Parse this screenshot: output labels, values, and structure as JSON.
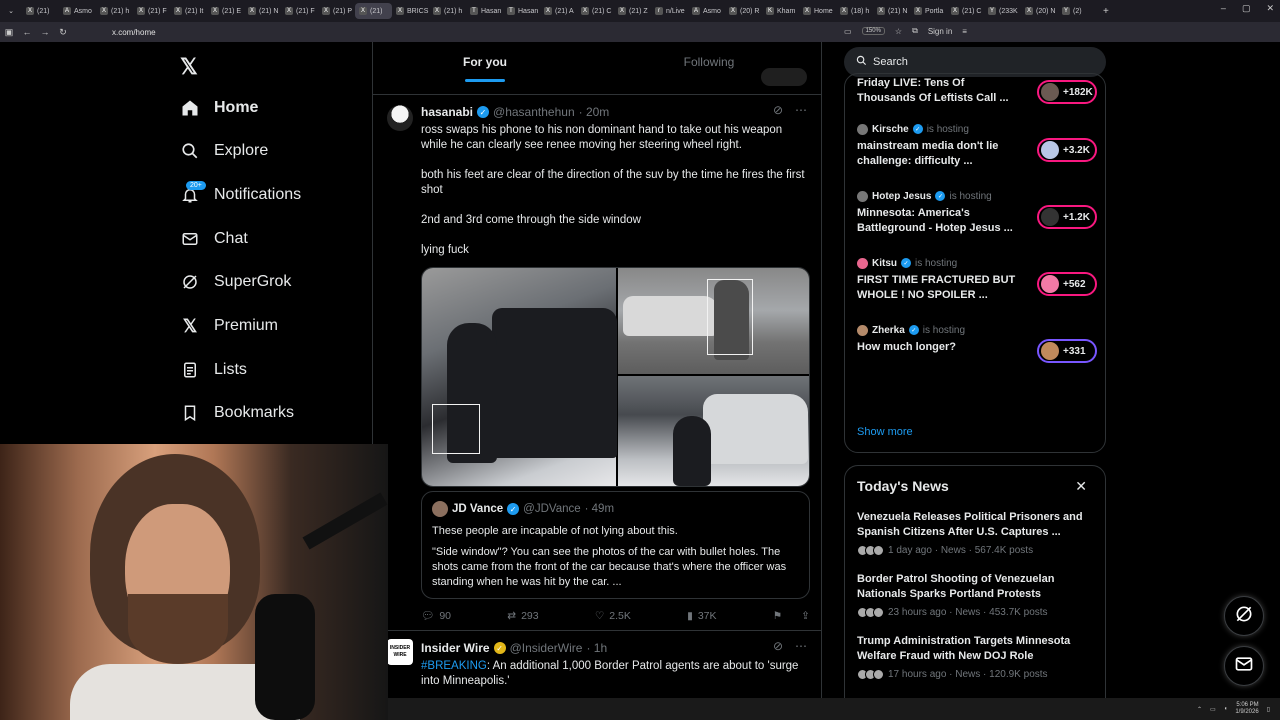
{
  "browser": {
    "tabs": [
      {
        "label": "(21)",
        "fav": "X"
      },
      {
        "label": "Asmo",
        "fav": "A"
      },
      {
        "label": "(21) h",
        "fav": "X"
      },
      {
        "label": "(21) F",
        "fav": "X"
      },
      {
        "label": "(21) It",
        "fav": "X"
      },
      {
        "label": "(21) E",
        "fav": "X"
      },
      {
        "label": "(21) N",
        "fav": "X"
      },
      {
        "label": "(21) F",
        "fav": "X"
      },
      {
        "label": "(21) P",
        "fav": "X"
      },
      {
        "label": "(21)",
        "fav": "X"
      },
      {
        "label": "BRICS",
        "fav": "X"
      },
      {
        "label": "(21) h",
        "fav": "X"
      },
      {
        "label": "Hasan",
        "fav": "T"
      },
      {
        "label": "Hasan",
        "fav": "T"
      },
      {
        "label": "(21) A",
        "fav": "X"
      },
      {
        "label": "(21) C",
        "fav": "X"
      },
      {
        "label": "(21) Z",
        "fav": "X"
      },
      {
        "label": "n/Live",
        "fav": "r"
      },
      {
        "label": "Asmo",
        "fav": "A"
      },
      {
        "label": "(20) R",
        "fav": "X"
      },
      {
        "label": "Kham",
        "fav": "K"
      },
      {
        "label": "Home",
        "fav": "X"
      },
      {
        "label": "(18) h",
        "fav": "X"
      },
      {
        "label": "(21) N",
        "fav": "X"
      },
      {
        "label": "Portla",
        "fav": "X"
      },
      {
        "label": "(21) C",
        "fav": "X"
      },
      {
        "label": "(233K",
        "fav": "Y"
      },
      {
        "label": "(20) N",
        "fav": "X"
      },
      {
        "label": "(2)",
        "fav": "Y"
      }
    ],
    "url": "x.com/home",
    "zoom": "150%",
    "sign_in": "Sign in"
  },
  "sidebar": {
    "items": [
      {
        "label": "Home",
        "icon": "home-icon"
      },
      {
        "label": "Explore",
        "icon": "search-icon"
      },
      {
        "label": "Notifications",
        "icon": "bell-icon",
        "badge": "20+"
      },
      {
        "label": "Chat",
        "icon": "mail-icon"
      },
      {
        "label": "SuperGrok",
        "icon": "grok-icon"
      },
      {
        "label": "Premium",
        "icon": "x-icon"
      },
      {
        "label": "Lists",
        "icon": "list-icon"
      },
      {
        "label": "Bookmarks",
        "icon": "bookmark-icon"
      }
    ]
  },
  "feed": {
    "tabs": [
      "For you",
      "Following"
    ],
    "tweet1": {
      "name": "hasanabi",
      "handle": "@hasanthehun",
      "time": "· 20m",
      "paragraphs": [
        "ross swaps his phone to his non dominant hand to take out his weapon while he can clearly see renee moving her steering wheel right.",
        "both his feet are clear of the direction of the suv by the time he fires the first shot",
        "2nd and 3rd come through the side window",
        "lying fuck"
      ],
      "quote": {
        "name": "JD Vance",
        "handle": "@JDVance",
        "time": "· 49m",
        "p1": "These people are incapable of not lying about this.",
        "p2": "\"Side window\"? You can see the photos of the car with bullet holes. The shots came from the front of the car because that's where the officer was standing when he was hit by the car. ..."
      },
      "stats": {
        "replies": "90",
        "reposts": "293",
        "likes": "2.5K",
        "views": "37K"
      }
    },
    "tweet2": {
      "name": "Insider Wire",
      "handle": "@InsiderWire",
      "time": "· 1h",
      "avatar_text": "INSIDER WIRE",
      "hashtag": "#BREAKING",
      "text": ": An additional 1,000 Border Patrol agents are about to 'surge into Minneapolis.'"
    }
  },
  "right": {
    "search_placeholder": "Search",
    "live": [
      {
        "host": "",
        "status": "",
        "title": "Friday LIVE: Tens Of Thousands Of Leftists Call ...",
        "count": "+182K",
        "pill": "pink"
      },
      {
        "host": "Kirsche",
        "status": "is hosting",
        "title": "mainstream media don't lie challenge: difficulty ...",
        "count": "+3.2K",
        "pill": "pink"
      },
      {
        "host": "Hotep Jesus",
        "status": "is hosting",
        "title": "Minnesota: America's Battleground - Hotep Jesus ...",
        "count": "+1.2K",
        "pill": "pink"
      },
      {
        "host": "Kitsu",
        "status": "is hosting",
        "title": "FIRST TIME FRACTURED BUT WHOLE ! NO SPOILER ...",
        "count": "+562",
        "pill": "pink"
      },
      {
        "host": "Zherka",
        "status": "is hosting",
        "title": "How much longer?",
        "count": "+331",
        "pill": "blue"
      }
    ],
    "show_more": "Show more",
    "news_title": "Today's News",
    "news": [
      {
        "title": "Venezuela Releases Political Prisoners and Spanish Citizens After U.S. Captures ...",
        "meta": "1 day ago · News · 567.4K posts"
      },
      {
        "title": "Border Patrol Shooting of Venezuelan Nationals Sparks Portland Protests",
        "meta": "23 hours ago · News · 453.7K posts"
      },
      {
        "title": "Trump Administration Targets Minnesota Welfare Fraud with New DOJ Role",
        "meta": "17 hours ago · News · 120.9K posts"
      }
    ]
  },
  "taskbar": {
    "time": "5:06 PM",
    "date": "1/9/2026"
  },
  "colors": {
    "accent": "#1d9bf0",
    "live_pill": "#f91880",
    "bg": "#000000"
  }
}
